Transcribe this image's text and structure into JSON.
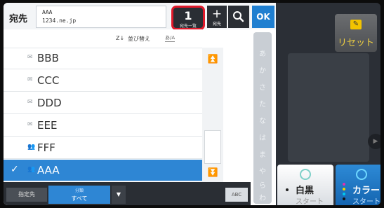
{
  "header": {
    "destination_label": "宛先",
    "address_line1": "AAA",
    "address_line2": "1234.ne.jp",
    "list_button_label": "宛先一覧",
    "list_button_count": "1",
    "add_button_plus": "+",
    "add_button_label": "宛先",
    "search_icon": "search-icon",
    "ok_label": "OK"
  },
  "toolbar": {
    "sort_icon_text": "Z↓",
    "sort_label": "並び替え",
    "kana_toggle": "あ/A"
  },
  "contacts": [
    {
      "name": "BBB",
      "icon": "mail-icon",
      "selected": false
    },
    {
      "name": "CCC",
      "icon": "mail-icon",
      "selected": false
    },
    {
      "name": "DDD",
      "icon": "mail-icon",
      "selected": false
    },
    {
      "name": "EEE",
      "icon": "mail-icon",
      "selected": false
    },
    {
      "name": "FFF",
      "icon": "group-icon",
      "selected": false
    },
    {
      "name": "AAA",
      "icon": "group-icon",
      "selected": true
    }
  ],
  "kana_index": [
    "あ",
    "か",
    "さ",
    "た",
    "な",
    "は",
    "ま",
    "や",
    "ら",
    "わ"
  ],
  "footer": {
    "destination_type": "指定先",
    "classification_label": "分類",
    "classification_value": "すべて",
    "abc_label": "ABC"
  },
  "right_panel": {
    "reset_label": "リセット",
    "start_bw_title": "白黒",
    "start_bw_sub": "スタート",
    "start_color_title": "カラー",
    "start_color_sub": "スタート"
  },
  "colors": {
    "accent_blue": "#2e86d4",
    "highlight_red": "#e0192a",
    "reset_yellow": "#f2c300"
  }
}
